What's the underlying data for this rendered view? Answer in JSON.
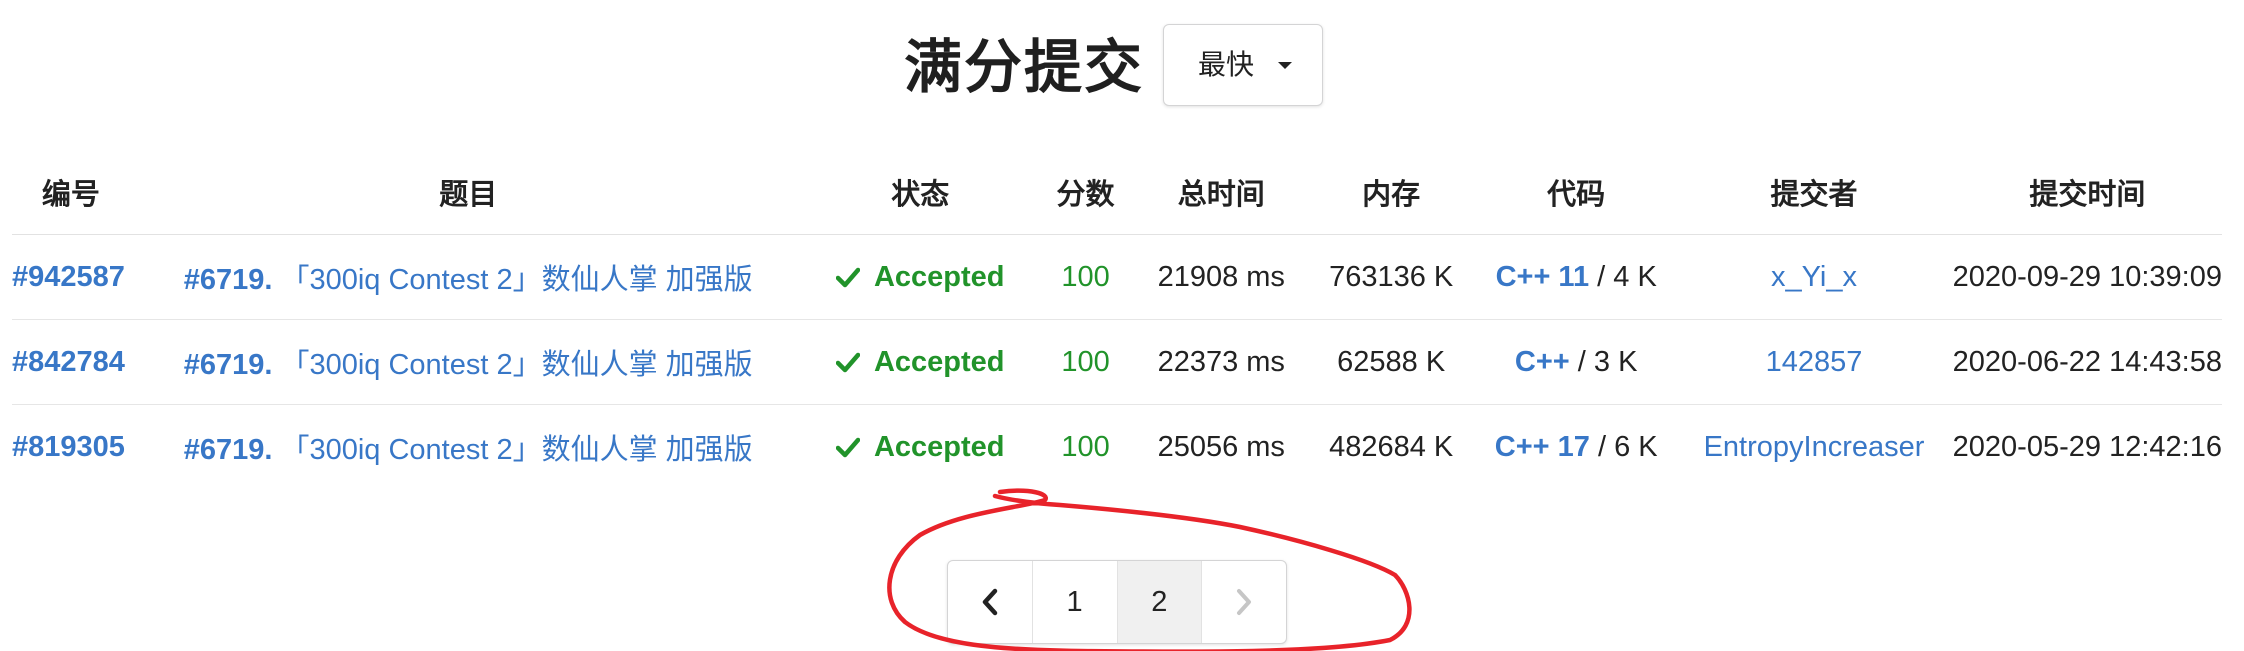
{
  "header": {
    "title": "满分提交",
    "sort_label": "最快",
    "sort_icon": "chevron-down-icon"
  },
  "table": {
    "columns": [
      "编号",
      "题目",
      "状态",
      "分数",
      "总时间",
      "内存",
      "代码",
      "提交者",
      "提交时间"
    ],
    "rows": [
      {
        "id": "#942587",
        "problem_num": "#6719.",
        "problem_title": "「300iq Contest 2」数仙人掌 加强版",
        "status": "Accepted",
        "score": "100",
        "time": "21908 ms",
        "memory": "763136 K",
        "code_lang": "C++ 11",
        "code_size": " / 4 K",
        "submitter": "x_Yi_x",
        "submit_time": "2020-09-29 10:39:09"
      },
      {
        "id": "#842784",
        "problem_num": "#6719.",
        "problem_title": "「300iq Contest 2」数仙人掌 加强版",
        "status": "Accepted",
        "score": "100",
        "time": "22373 ms",
        "memory": "62588 K",
        "code_lang": "C++",
        "code_size": " / 3 K",
        "submitter": "142857",
        "submit_time": "2020-06-22 14:43:58"
      },
      {
        "id": "#819305",
        "problem_num": "#6719.",
        "problem_title": "「300iq Contest 2」数仙人掌 加强版",
        "status": "Accepted",
        "score": "100",
        "time": "25056 ms",
        "memory": "482684 K",
        "code_lang": "C++ 17",
        "code_size": " / 6 K",
        "submitter": "EntropyIncreaser",
        "submit_time": "2020-05-29 12:42:16"
      }
    ],
    "status_icon": "check-icon"
  },
  "pagination": {
    "prev_icon": "chevron-left-icon",
    "next_icon": "chevron-right-icon",
    "pages": [
      "1",
      "2"
    ],
    "current_page": "2"
  },
  "colors": {
    "link": "#3877c7",
    "accepted": "#21932a",
    "annotation": "#e8232a"
  }
}
